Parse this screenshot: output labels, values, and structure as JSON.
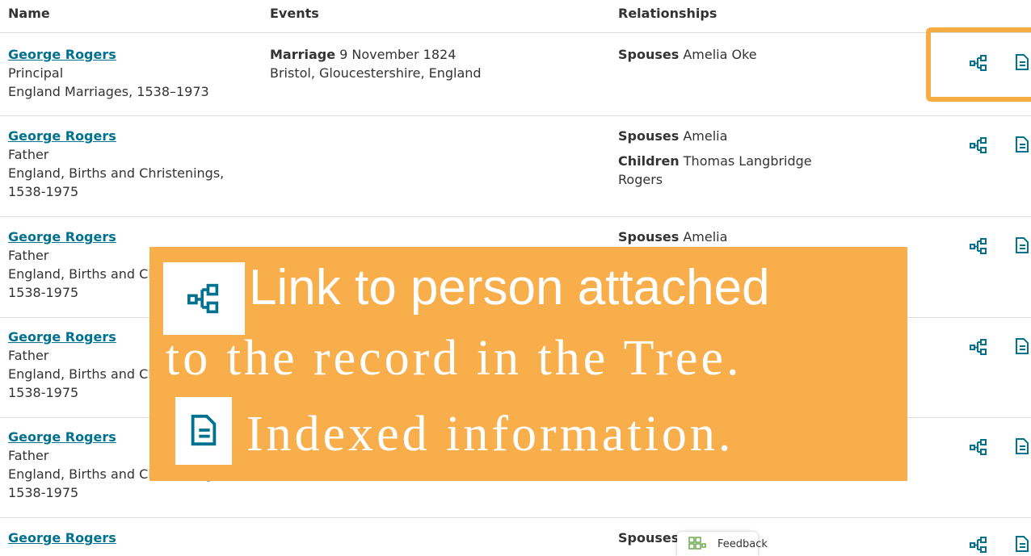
{
  "headers": {
    "name": "Name",
    "events": "Events",
    "relationships": "Relationships"
  },
  "rows": [
    {
      "name": "George Rogers",
      "role": "Principal",
      "collection": "England Marriages, 1538–1973",
      "event_type": "Marriage",
      "event_date": "9 November 1824",
      "event_place": "Bristol, Gloucestershire, England",
      "spouses_label": "Spouses",
      "spouses": "Amelia Oke"
    },
    {
      "name": "George Rogers",
      "role": "Father",
      "collection": "England, Births and Christenings, 1538-1975",
      "spouses_label": "Spouses",
      "spouses": "Amelia",
      "children_label": "Children",
      "children": "Thomas Langbridge Rogers"
    },
    {
      "name": "George Rogers",
      "role": "Father",
      "collection": "England, Births and Christenings, 1538-1975",
      "spouses_label": "Spouses",
      "spouses": "Amelia"
    },
    {
      "name": "George Rogers",
      "role": "Father",
      "collection": "England, Births and Christenings, 1538-1975"
    },
    {
      "name": "George Rogers",
      "role": "Father",
      "collection": "England, Births and Christenings, 1538-1975"
    },
    {
      "name": "George Rogers",
      "spouses_label": "Spouses"
    }
  ],
  "overlay": {
    "line1": "Link to person attached",
    "line2": "to the record in the Tree.",
    "line3": "Indexed information."
  },
  "feedback": {
    "label": "Feedback"
  },
  "colors": {
    "link": "#00718f",
    "overlay": "#f8ae4b",
    "highlight": "#f8ac46"
  },
  "icons": [
    "tree-link-icon",
    "document-icon",
    "feedback-icon"
  ]
}
